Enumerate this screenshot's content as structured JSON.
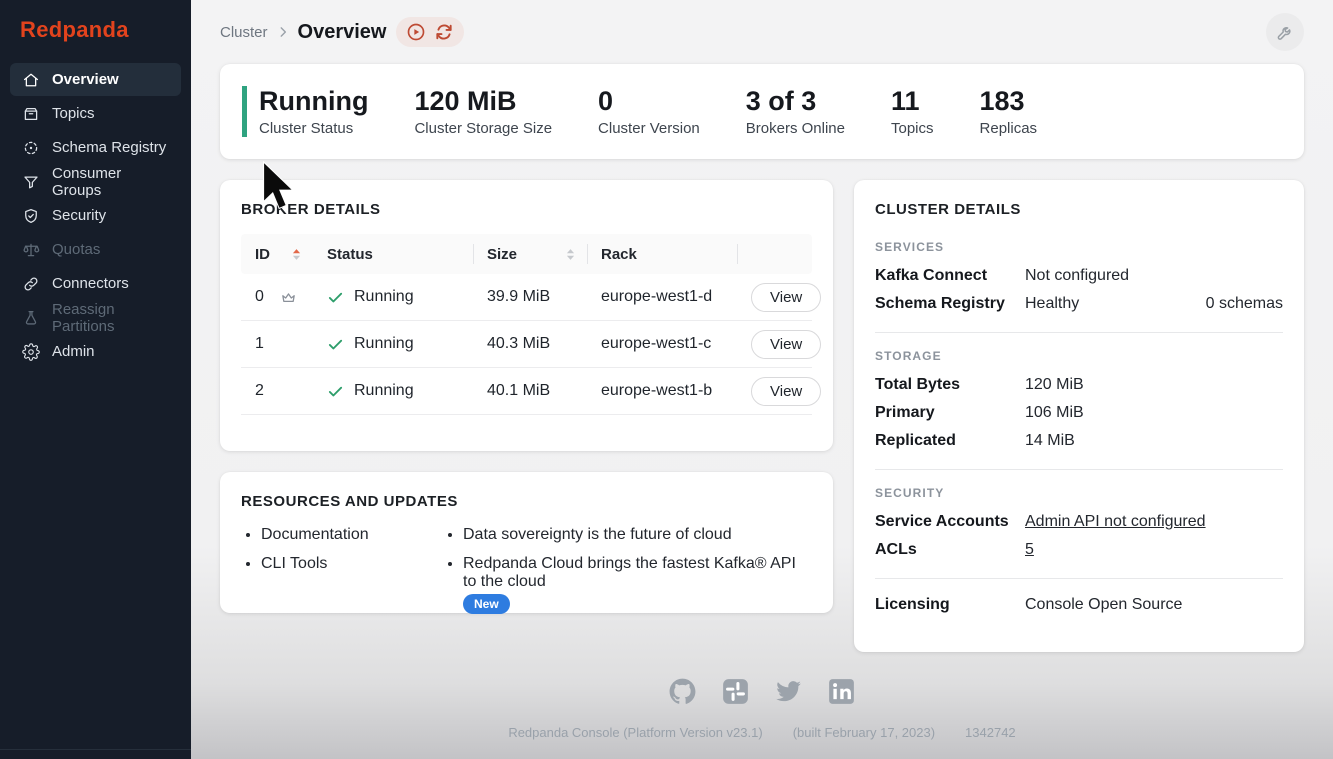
{
  "sidebar": {
    "logo": "Redpanda",
    "items": [
      {
        "label": "Overview",
        "icon": "home-icon",
        "active": true,
        "disabled": false
      },
      {
        "label": "Topics",
        "icon": "topics-icon",
        "active": false,
        "disabled": false
      },
      {
        "label": "Schema Registry",
        "icon": "schema-registry-icon",
        "active": false,
        "disabled": false
      },
      {
        "label": "Consumer Groups",
        "icon": "consumer-groups-icon",
        "active": false,
        "disabled": false
      },
      {
        "label": "Security",
        "icon": "security-icon",
        "active": false,
        "disabled": false
      },
      {
        "label": "Quotas",
        "icon": "quotas-icon",
        "active": false,
        "disabled": true
      },
      {
        "label": "Connectors",
        "icon": "connectors-icon",
        "active": false,
        "disabled": false
      },
      {
        "label": "Reassign Partitions",
        "icon": "reassign-partitions-icon",
        "active": false,
        "disabled": true
      },
      {
        "label": "Admin",
        "icon": "admin-icon",
        "active": false,
        "disabled": false
      }
    ]
  },
  "header": {
    "breadcrumb_parent": "Cluster",
    "breadcrumb_current": "Overview"
  },
  "stats": [
    {
      "value": "Running",
      "label": "Cluster Status",
      "accent": true
    },
    {
      "value": "120 MiB",
      "label": "Cluster Storage Size"
    },
    {
      "value": "0",
      "label": "Cluster Version"
    },
    {
      "value": "3 of 3",
      "label": "Brokers Online"
    },
    {
      "value": "11",
      "label": "Topics"
    },
    {
      "value": "183",
      "label": "Replicas"
    }
  ],
  "broker_details": {
    "title": "BROKER DETAILS",
    "columns": [
      {
        "label": "ID",
        "sorted": "asc"
      },
      {
        "label": "Status",
        "sorted": null
      },
      {
        "label": "Size",
        "sorted": "none"
      },
      {
        "label": "Rack",
        "sorted": null
      },
      {
        "label": "",
        "sorted": null
      }
    ],
    "rows": [
      {
        "id": "0",
        "controller": true,
        "status": "Running",
        "size": "39.9 MiB",
        "rack": "europe-west1-d",
        "action": "View"
      },
      {
        "id": "1",
        "controller": false,
        "status": "Running",
        "size": "40.3 MiB",
        "rack": "europe-west1-c",
        "action": "View"
      },
      {
        "id": "2",
        "controller": false,
        "status": "Running",
        "size": "40.1 MiB",
        "rack": "europe-west1-b",
        "action": "View"
      }
    ]
  },
  "resources": {
    "title": "RESOURCES AND UPDATES",
    "left_links": [
      {
        "text": "Documentation"
      },
      {
        "text": "CLI Tools"
      }
    ],
    "right_links": [
      {
        "text": "Data sovereignty is the future of cloud"
      },
      {
        "text": "Redpanda Cloud brings the fastest Kafka® API to the cloud",
        "badge": "New"
      }
    ]
  },
  "cluster_details": {
    "title": "CLUSTER DETAILS",
    "sections": [
      {
        "heading": "SERVICES",
        "rows": [
          {
            "label": "Kafka Connect",
            "value": "Not configured"
          },
          {
            "label": "Schema Registry",
            "value": "Healthy",
            "extra": "0 schemas"
          }
        ]
      },
      {
        "heading": "STORAGE",
        "rows": [
          {
            "label": "Total Bytes",
            "value": "120 MiB"
          },
          {
            "label": "Primary",
            "value": "106 MiB"
          },
          {
            "label": "Replicated",
            "value": "14 MiB"
          }
        ]
      },
      {
        "heading": "SECURITY",
        "rows": [
          {
            "label": "Service Accounts",
            "value": "Admin API not configured",
            "link": true
          },
          {
            "label": "ACLs",
            "value": "5",
            "link": true
          }
        ]
      },
      {
        "heading": "",
        "rows": [
          {
            "label": "Licensing",
            "value": "Console Open Source"
          }
        ]
      }
    ]
  },
  "footer": {
    "icons": [
      "github-icon",
      "slack-icon",
      "twitter-icon",
      "linkedin-icon"
    ],
    "text_parts": [
      "Redpanda Console (Platform Version v23.1)",
      "(built February 17, 2023)",
      "1342742"
    ]
  },
  "colors": {
    "brand_red": "#E2431D",
    "accent_green": "#2FA380",
    "check_green": "#2E9E6B",
    "sort_active_red": "#E2684A",
    "badge_blue": "#2E7CE0",
    "sidebar_bg": "#161D29"
  }
}
